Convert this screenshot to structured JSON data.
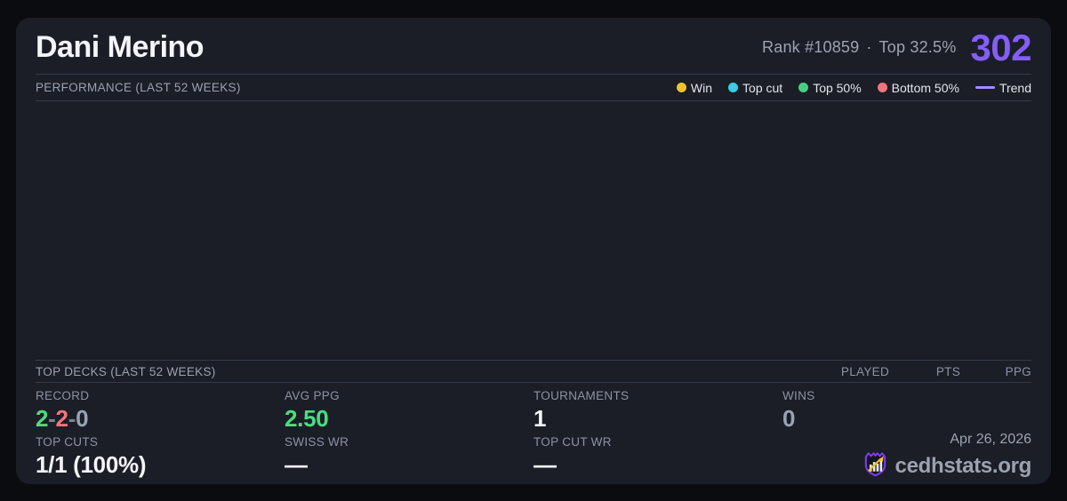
{
  "player": {
    "name": "Dani Merino",
    "rank_label": "Rank #10859",
    "separator": "·",
    "percentile_label": "Top 32.5%",
    "points": "302"
  },
  "performance": {
    "title": "PERFORMANCE (LAST 52 WEEKS)",
    "legend": [
      {
        "label": "Win",
        "color": "#f0c429",
        "swatch": "dot"
      },
      {
        "label": "Top cut",
        "color": "#38cde8",
        "swatch": "dot"
      },
      {
        "label": "Top 50%",
        "color": "#43d17f",
        "swatch": "dot"
      },
      {
        "label": "Bottom 50%",
        "color": "#f3747c",
        "swatch": "dot"
      },
      {
        "label": "Trend",
        "color": "#a78bfa",
        "swatch": "line"
      }
    ],
    "chart_data": {
      "type": "scatter",
      "x": [],
      "series": [],
      "title": "",
      "note": "chart area is empty - no data points rendered"
    }
  },
  "top_decks": {
    "title": "TOP DECKS (LAST 52 WEEKS)",
    "columns": [
      "PLAYED",
      "PTS",
      "PPG"
    ],
    "rows": []
  },
  "stats": {
    "record": {
      "label": "RECORD",
      "wins": "2",
      "losses": "2",
      "draws": "0",
      "sep": "-"
    },
    "avg_ppg": {
      "label": "AVG PPG",
      "value": "2.50"
    },
    "tournaments": {
      "label": "TOURNAMENTS",
      "value": "1"
    },
    "wins": {
      "label": "WINS",
      "value": "0"
    },
    "top_cuts": {
      "label": "TOP CUTS",
      "value": "1/1 (100%)"
    },
    "swiss_wr": {
      "label": "SWISS WR",
      "value": "—"
    },
    "top_cut_wr": {
      "label": "TOP CUT WR",
      "value": "—"
    }
  },
  "footer": {
    "date": "Apr 26, 2026",
    "brand": "cedhstats.org",
    "logo_icon": "shield-bar-chart-arrow"
  },
  "colors": {
    "background": "#0b0c10",
    "card": "#1b1e27",
    "accent_purple": "#845ef7",
    "win_green": "#4ade80",
    "loss_red": "#f3747c",
    "neutral_gray": "#9aa3b2",
    "trend_purple": "#a78bfa",
    "logo_purple": "#7c3aed",
    "logo_gold": "#f5c518"
  }
}
